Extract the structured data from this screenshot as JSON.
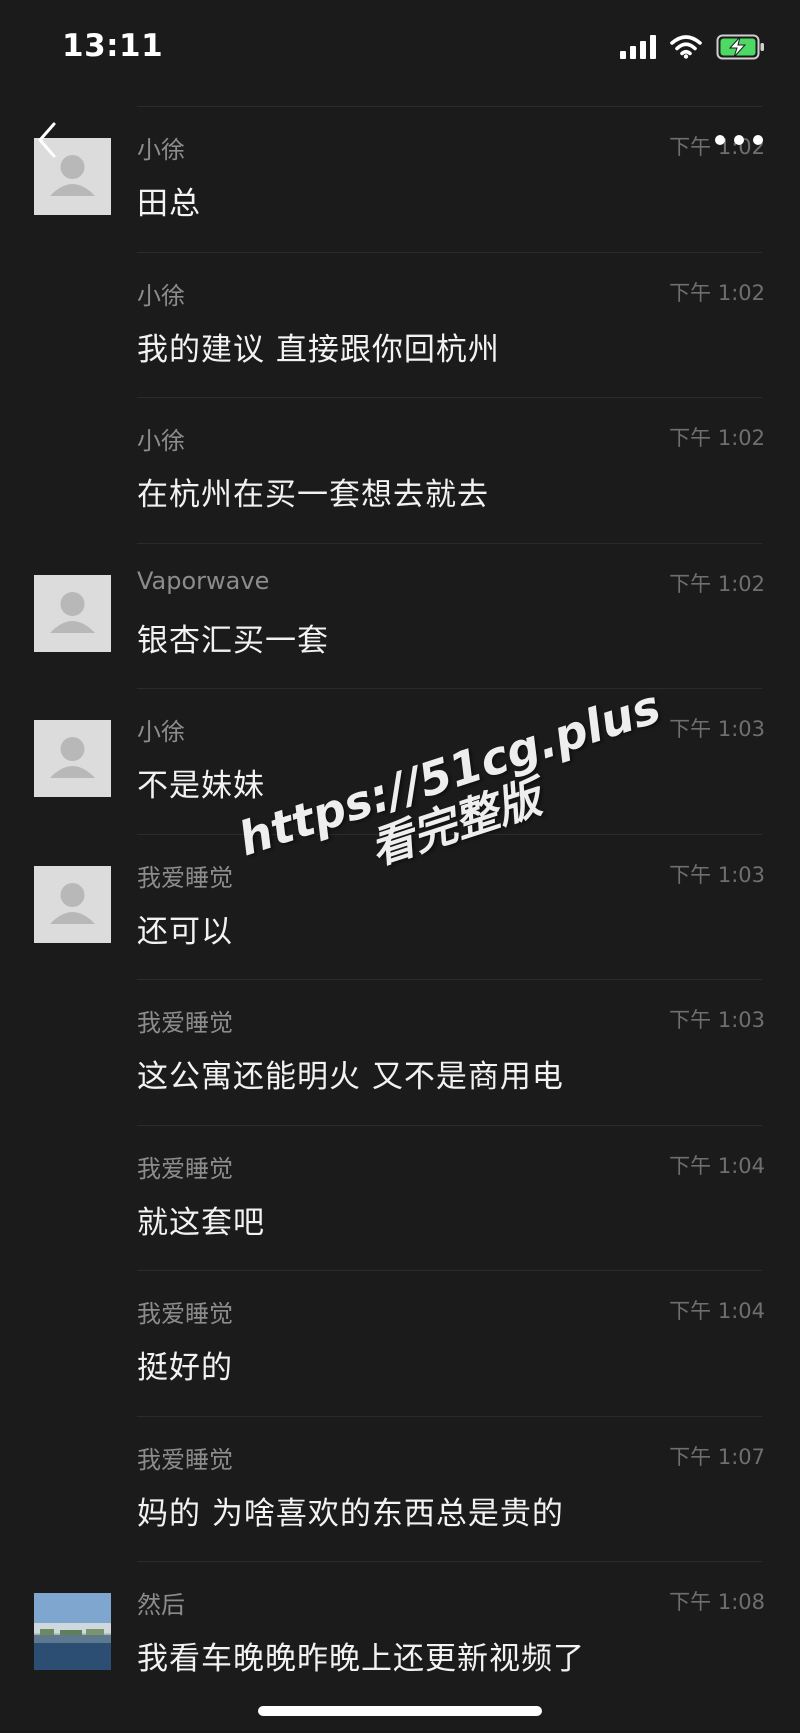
{
  "status_bar": {
    "time": "13:11",
    "icons": [
      "signal-icon",
      "wifi-icon",
      "battery-charging-icon"
    ],
    "battery_color": "#4cd964"
  },
  "nav": {
    "back_icon": "chevron-left-icon",
    "more_icon": "more-dots-icon"
  },
  "messages": [
    {
      "sender": "小徐",
      "time": "下午 1:02",
      "text": "田总",
      "avatar": "default"
    },
    {
      "sender": "小徐",
      "time": "下午 1:02",
      "text": "我的建议 直接跟你回杭州",
      "avatar": "none"
    },
    {
      "sender": "小徐",
      "time": "下午 1:02",
      "text": "在杭州在买一套想去就去",
      "avatar": "none"
    },
    {
      "sender": "Vaporwave",
      "time": "下午 1:02",
      "text": "银杏汇买一套",
      "avatar": "default"
    },
    {
      "sender": "小徐",
      "time": "下午 1:03",
      "text": "不是妹妹",
      "avatar": "default"
    },
    {
      "sender": "我爱睡觉",
      "time": "下午 1:03",
      "text": "还可以",
      "avatar": "default"
    },
    {
      "sender": "我爱睡觉",
      "time": "下午 1:03",
      "text": "这公寓还能明火 又不是商用电",
      "avatar": "none"
    },
    {
      "sender": "我爱睡觉",
      "time": "下午 1:04",
      "text": "就这套吧",
      "avatar": "none"
    },
    {
      "sender": "我爱睡觉",
      "time": "下午 1:04",
      "text": "挺好的",
      "avatar": "none"
    },
    {
      "sender": "我爱睡觉",
      "time": "下午 1:07",
      "text": "妈的 为啥喜欢的东西总是贵的",
      "avatar": "none"
    },
    {
      "sender": "然后",
      "time": "下午 1:08",
      "text": "我看车晚晚昨晚上还更新视频了",
      "avatar": "photo"
    }
  ],
  "watermark": {
    "line1": "https://51cg.plus",
    "line2": "看完整版"
  }
}
